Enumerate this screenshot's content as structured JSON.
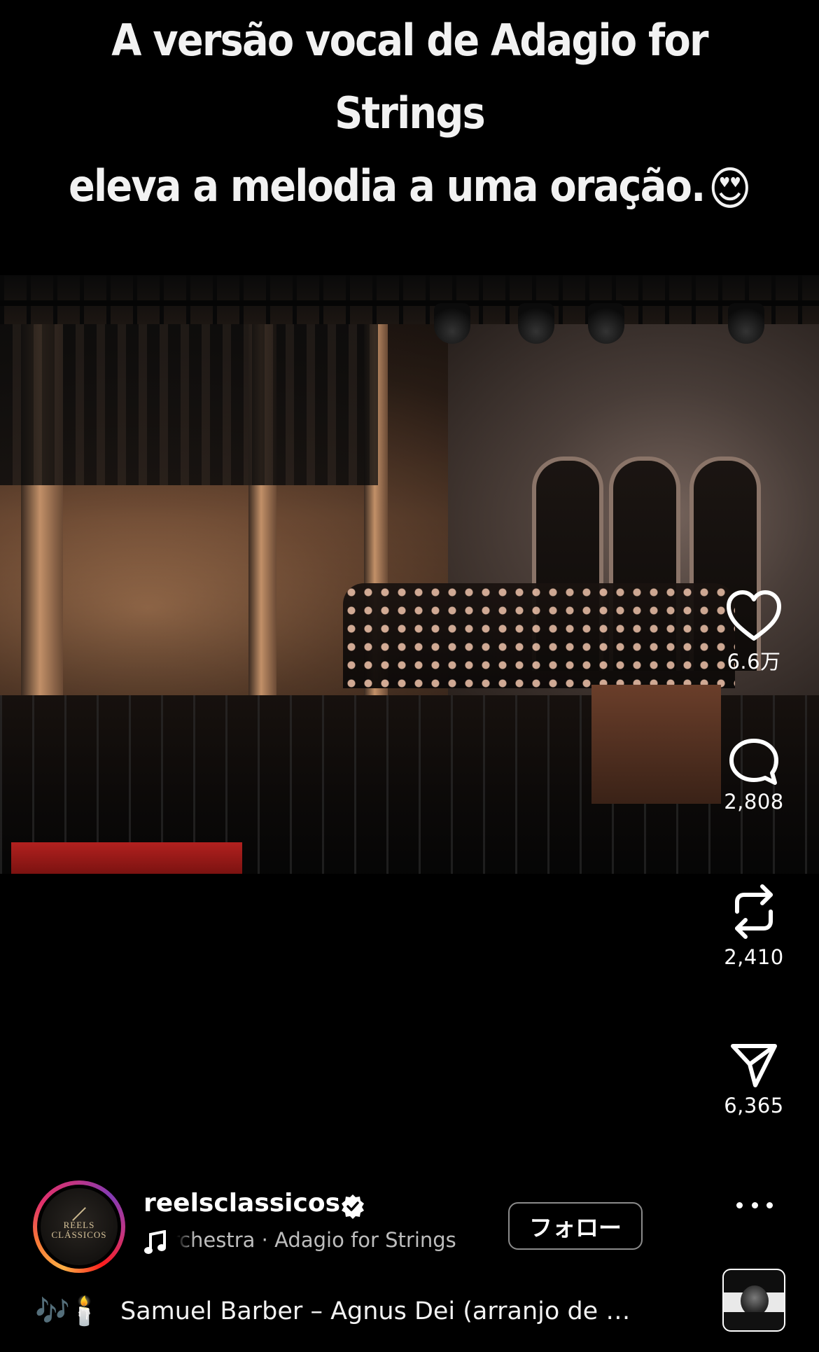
{
  "caption": {
    "line1": "A versão vocal de Adagio for Strings",
    "line2": "eleva a melodia a uma oração.",
    "emoji": "😍"
  },
  "actions": {
    "like": {
      "icon": "heart-icon",
      "count": "6.6万"
    },
    "comment": {
      "icon": "comment-bubble-icon",
      "count": "2,808"
    },
    "repost": {
      "icon": "repost-icon",
      "count": "2,410"
    },
    "share": {
      "icon": "paper-plane-icon",
      "count": "6,365"
    }
  },
  "author": {
    "username": "reelsclassicos",
    "verified": true,
    "avatar_text_line1": "REELS",
    "avatar_text_line2": "CLÁSSICOS",
    "follow_label": "フォロー",
    "more_icon": "more-dots-icon"
  },
  "audio": {
    "icon": "music-note-icon",
    "track": "Orchestra · Adagio for Strings"
  },
  "description": {
    "emoji": "🎶🕯️",
    "text": "Samuel Barber – Agnus Dei (arranjo de Adagio for Strings)"
  },
  "colors": {
    "background": "#000000",
    "text": "#ffffff",
    "secondary_text": "#bdbdbd",
    "follow_border": "#8b8b8b",
    "ring_gradient": [
      "#fcaf45",
      "#f77737",
      "#e1306c",
      "#c13584",
      "#833ab4"
    ]
  }
}
